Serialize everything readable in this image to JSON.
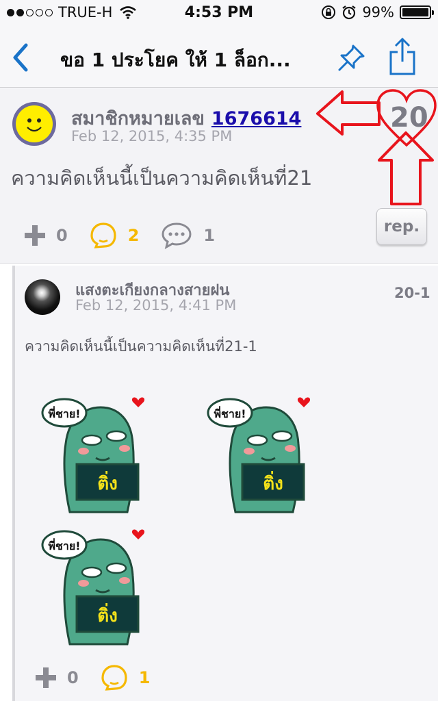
{
  "status_bar": {
    "carrier": "TRUE-H",
    "time": "4:53 PM",
    "battery": "99%",
    "battery_level": 0.99
  },
  "nav": {
    "title": "ขอ 1 ประโยค ให้ 1 ล็อก...",
    "icons": [
      "back-chevron-icon",
      "pin-icon",
      "share-icon"
    ],
    "accent_color": "#1a73c8"
  },
  "comment": {
    "author_prefix": "สมาชิกหมายเลข",
    "author_id": "1676614",
    "timestamp": "Feb 12, 2015, 4:35 PM",
    "number": "20",
    "text": "ความคิดเห็นนี้เป็นความคิดเห็นที่21",
    "plus_count": "0",
    "emotion_count": "2",
    "reply_count": "1",
    "rep_label": "rep."
  },
  "reply": {
    "author": "แสงตะเกียงกลางสายฝน",
    "timestamp": "Feb 12, 2015, 4:41 PM",
    "number": "20-1",
    "text": "ความคิดเห็นนี้เป็นความคิดเห็นที่21-1",
    "sticker_caption": "พี่ชาย!",
    "sticker_sign": "ติ่ง",
    "plus_count": "0",
    "emotion_count": "1"
  },
  "colors": {
    "emotion": "#f5b800",
    "annotation": "#e8141c",
    "link": "#1a0dab"
  }
}
